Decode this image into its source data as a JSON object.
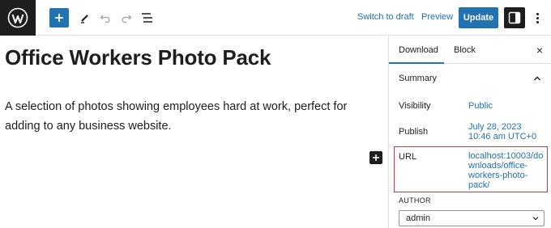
{
  "toolbar": {
    "switch_to_draft": "Switch to draft",
    "preview": "Preview",
    "update": "Update",
    "icons": [
      "wordpress-logo",
      "add-block",
      "edit-tools",
      "undo",
      "redo",
      "document-overview",
      "settings",
      "more-options"
    ]
  },
  "post": {
    "title": "Office Workers Photo Pack",
    "body": "A selection of photos showing employees hard at work, perfect for adding to any business website."
  },
  "sidebar": {
    "tabs": [
      "Download",
      "Block"
    ],
    "close": "×",
    "summary_heading": "Summary",
    "visibility_label": "Visibility",
    "visibility_value": "Public",
    "publish_label": "Publish",
    "publish_value_line1": "July 28, 2023",
    "publish_value_line2": "10:46 am UTC+0",
    "url_label": "URL",
    "url_line1": "localhost:10003/do",
    "url_line2": "wnloads/office-",
    "url_line3": "workers-photo-",
    "url_line4": "pack/",
    "author_label": "AUTHOR",
    "author_value": "admin"
  },
  "colors": {
    "accent": "#2271b1",
    "highlight_border": "#d63638",
    "dark": "#1e1e1e"
  }
}
